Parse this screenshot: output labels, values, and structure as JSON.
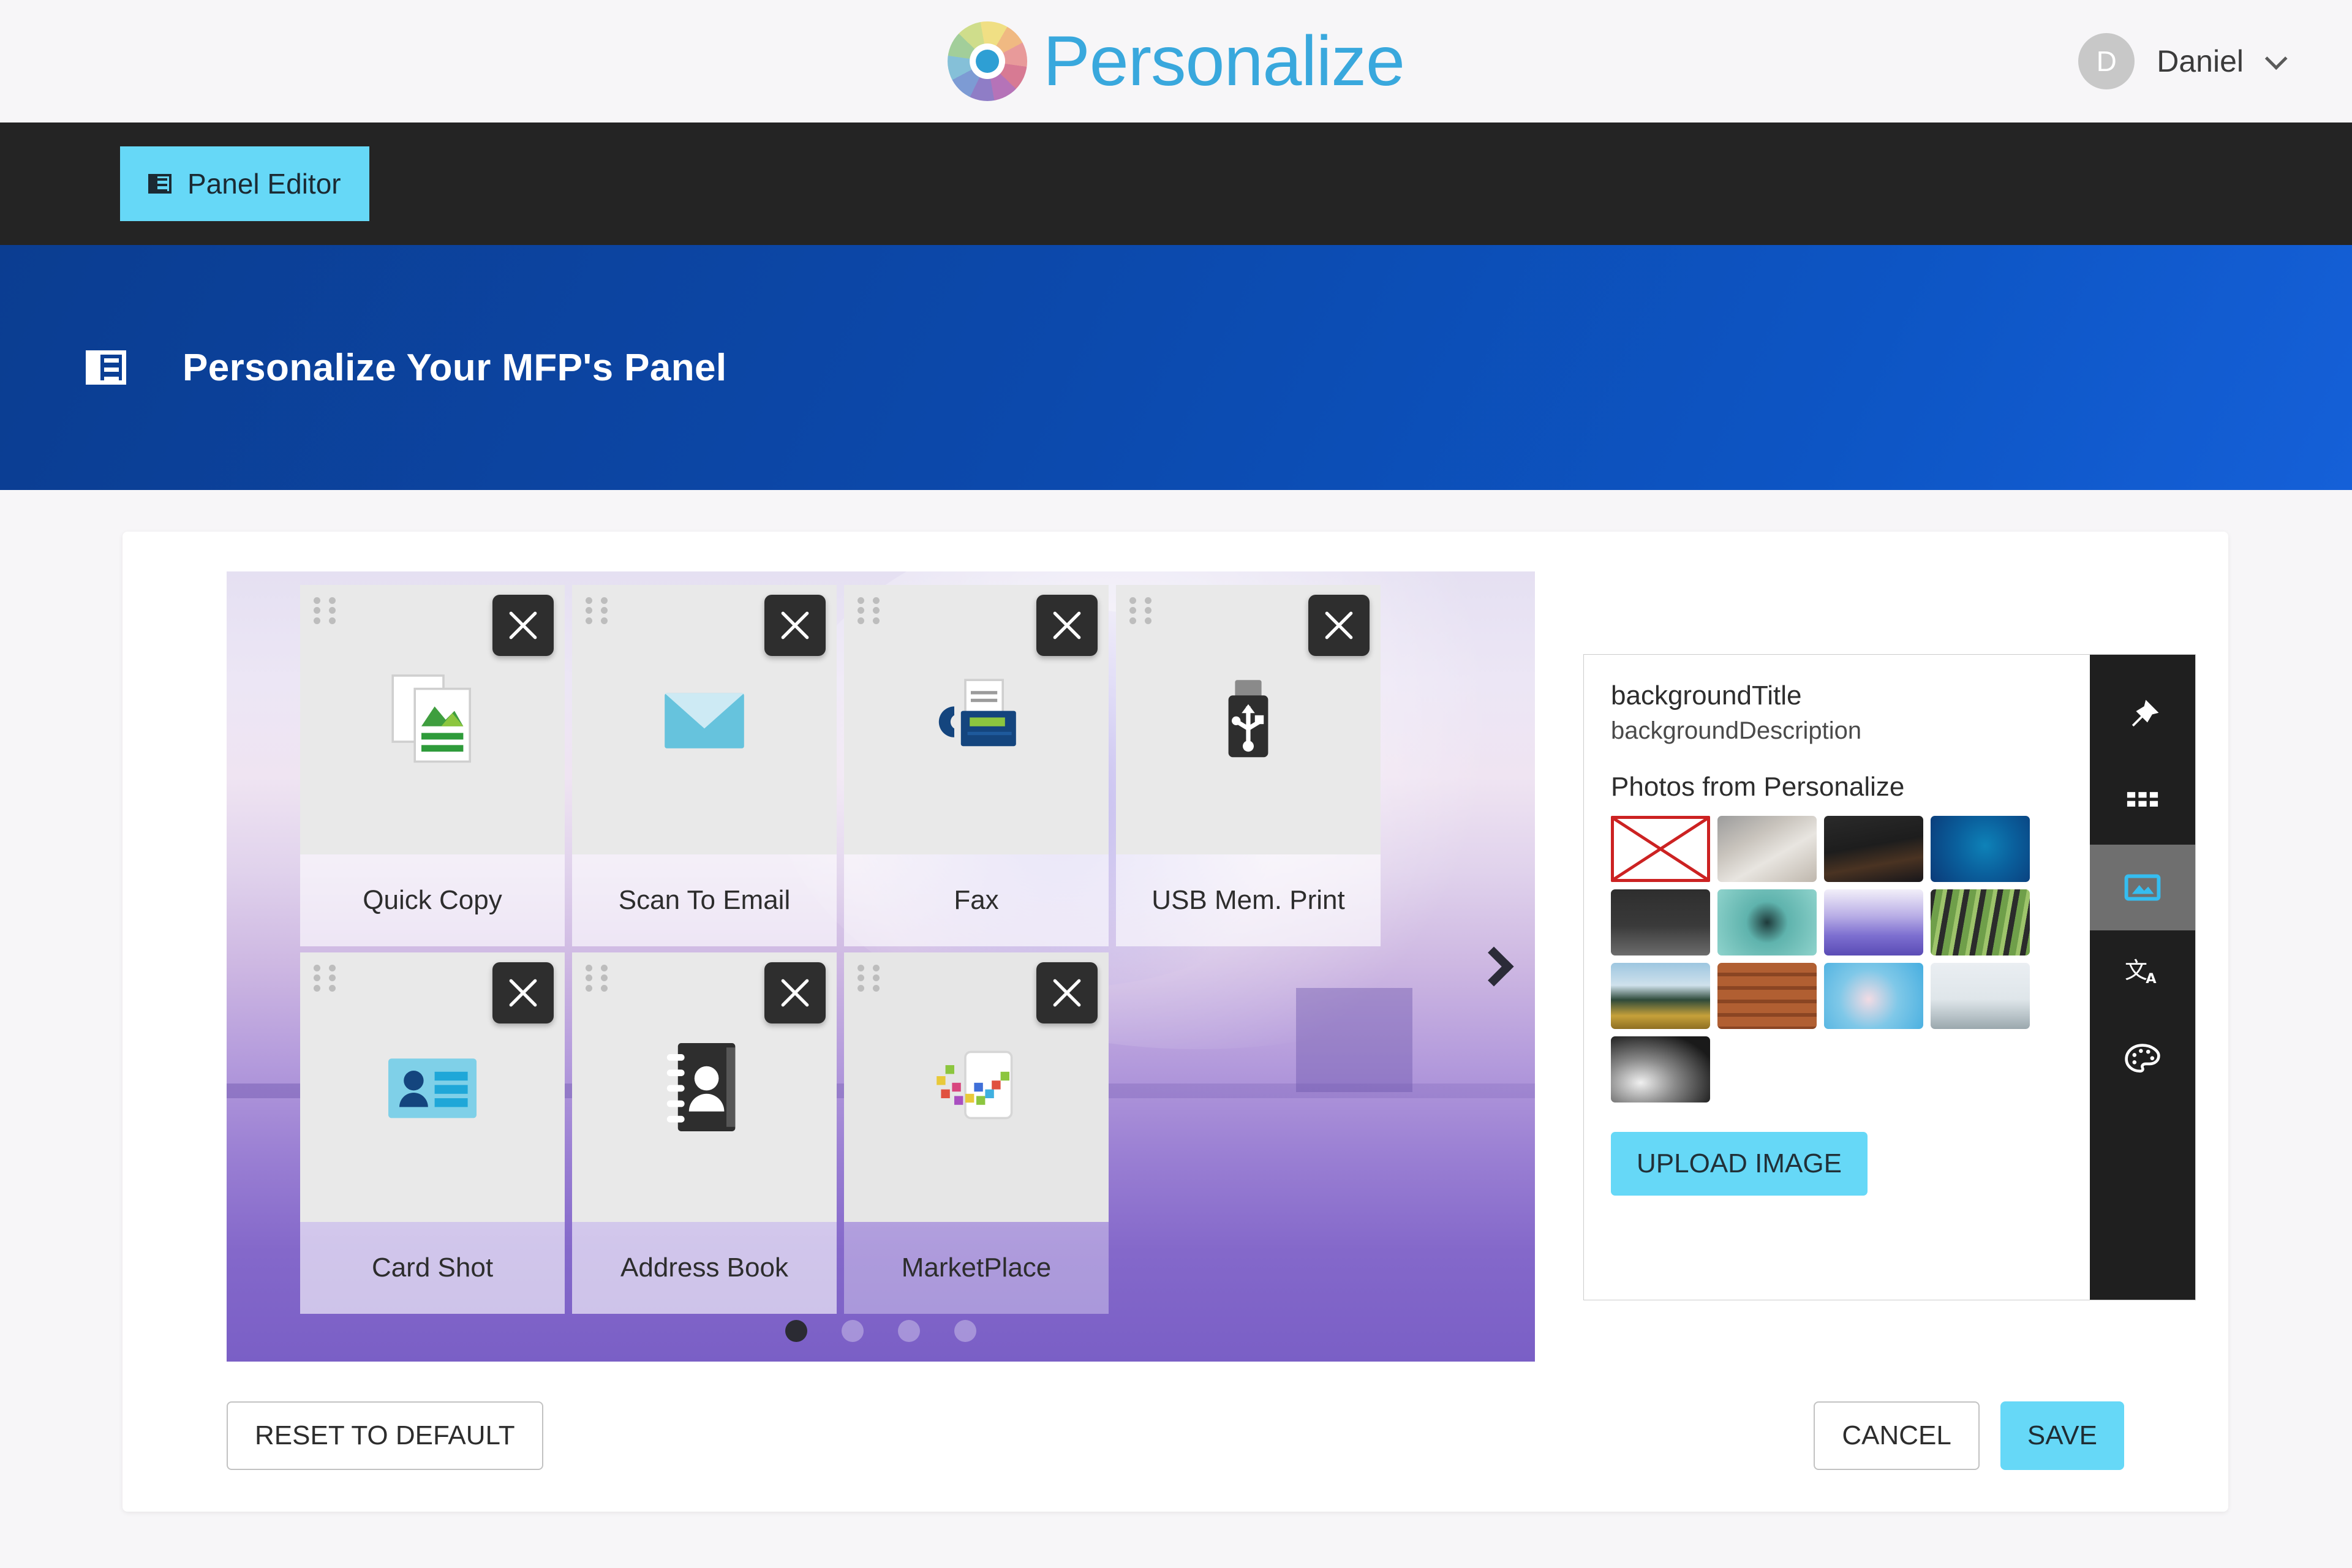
{
  "brand": {
    "name": "Personalize",
    "logo_icon": "color-wheel-icon"
  },
  "user": {
    "initial": "D",
    "name": "Daniel",
    "chevron_icon": "chevron-down-icon"
  },
  "nav": {
    "tab_label": "Panel Editor",
    "tab_icon": "panel-layout-icon"
  },
  "banner": {
    "title": "Personalize Your MFP's Panel",
    "icon": "panel-layout-icon"
  },
  "panel_preview": {
    "tiles": [
      {
        "label": "Quick Copy",
        "icon": "documents-image-icon",
        "remove_icon": "close-icon",
        "drag_icon": "drag-handle-icon"
      },
      {
        "label": "Scan To Email",
        "icon": "envelope-icon",
        "remove_icon": "close-icon",
        "drag_icon": "drag-handle-icon"
      },
      {
        "label": "Fax",
        "icon": "fax-machine-icon",
        "remove_icon": "close-icon",
        "drag_icon": "drag-handle-icon"
      },
      {
        "label": "USB Mem. Print",
        "icon": "usb-drive-icon",
        "remove_icon": "close-icon",
        "drag_icon": "drag-handle-icon"
      },
      {
        "label": "Card Shot",
        "icon": "id-card-icon",
        "remove_icon": "close-icon",
        "drag_icon": "drag-handle-icon"
      },
      {
        "label": "Address Book",
        "icon": "address-book-icon",
        "remove_icon": "close-icon",
        "drag_icon": "drag-handle-icon"
      },
      {
        "label": "MarketPlace",
        "icon": "marketplace-icon",
        "remove_icon": "close-icon",
        "drag_icon": "drag-handle-icon"
      }
    ],
    "page_count": 4,
    "active_page": 1,
    "next_page_icon": "chevron-right-icon"
  },
  "background_panel": {
    "title": "backgroundTitle",
    "description": "backgroundDescription",
    "section_label": "Photos from Personalize",
    "upload_label": "UPLOAD IMAGE",
    "thumbnails": [
      {
        "name": "broken-image",
        "broken": true,
        "css": ""
      },
      {
        "name": "cat-photo",
        "broken": false,
        "css": "linear-gradient(150deg,#9c9c9c 0%,#c9c4bd 35%,#e8e5e0 60%,#bfb7ad 100%)"
      },
      {
        "name": "night-festival",
        "broken": false,
        "css": "linear-gradient(170deg,#2a2a2a 0%,#1d1d1d 45%,#4a3322 70%,#17161a 100%)"
      },
      {
        "name": "blue-ocean",
        "broken": false,
        "css": "radial-gradient(circle at 55% 45%,#0e82b8 0%,#0a5f9c 45%,#0b3a78 100%)"
      },
      {
        "name": "dark-texture",
        "broken": false,
        "css": "linear-gradient(180deg,#2e2e2e 0%,#3a3a3a 55%,#6c6c6c 100%)"
      },
      {
        "name": "teal-succulent",
        "broken": false,
        "css": "radial-gradient(circle at 50% 50%,#1e3a3a 0%,#5fb3ad 35%,#8fd3cc 100%)"
      },
      {
        "name": "purple-sunset",
        "broken": false,
        "css": "linear-gradient(180deg,#f2eff9 0%,#b9aee6 40%,#7d6fd0 70%,#5a4bb5 100%)"
      },
      {
        "name": "bamboo-forest",
        "broken": false,
        "css": "repeating-linear-gradient(100deg,#2b2b2b 0 9px,#6f9f4a 9px 20px,#9ec46b 20px 27px)"
      },
      {
        "name": "field-landscape",
        "broken": false,
        "css": "linear-gradient(180deg,#9dc6e0 0%,#cfe1ec 34%,#2e4a3a 56%,#c6a13a 80%,#8e6f22 100%)"
      },
      {
        "name": "wood-planks",
        "broken": false,
        "css": "repeating-linear-gradient(180deg,#b15f32 0 16px,#8a4523 16px 22px)"
      },
      {
        "name": "cherry-blossom",
        "broken": false,
        "css": "radial-gradient(circle at 45% 55%,#f2dbe4 0%,#7fc8e8 45%,#46aee0 100%)"
      },
      {
        "name": "misty-landscape",
        "broken": false,
        "css": "linear-gradient(180deg,#eaeef2 0%,#dfe6ea 55%,#b9c4c9 80%,#9aa7ad 100%)"
      },
      {
        "name": "monochrome-waves",
        "broken": false,
        "css": "radial-gradient(ellipse at 30% 70%,#f0f0f0 0%,#8a8a8a 35%,#1a1a1a 80%)"
      }
    ],
    "rail": [
      {
        "name": "pin",
        "icon": "pushpin-icon",
        "active": false
      },
      {
        "name": "apps",
        "icon": "grid-apps-icon",
        "active": false
      },
      {
        "name": "image",
        "icon": "image-icon",
        "active": true
      },
      {
        "name": "translate",
        "icon": "translate-icon",
        "active": false
      },
      {
        "name": "theme",
        "icon": "palette-icon",
        "active": false
      }
    ]
  },
  "actions": {
    "reset_label": "RESET TO DEFAULT",
    "cancel_label": "CANCEL",
    "save_label": "SAVE"
  },
  "colors": {
    "accent_cyan": "#66d8f7",
    "banner_blue": "#0c49ac",
    "nav_dark": "#242424",
    "rail_dark": "#1f1f1f"
  }
}
